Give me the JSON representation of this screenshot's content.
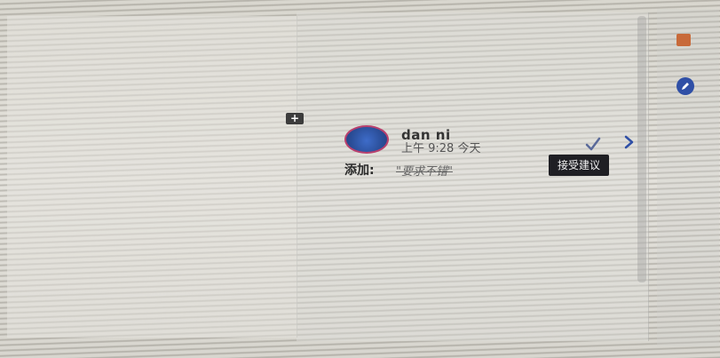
{
  "comment": {
    "author": "dan ni",
    "time": "上午 9:28 今天",
    "change_label": "添加:",
    "change_text": "\"要求不错\""
  },
  "actions": {
    "accept_icon": "checkmark-icon",
    "next_icon": "chevron-right-icon",
    "accept_tooltip": "接受建议",
    "add_comment_icon": "plus-icon"
  },
  "sidebar": {
    "orange_icon": "square-icon",
    "blue_icon": "circle-icon"
  },
  "colors": {
    "avatar_border": "#b8406e",
    "avatar_fill": "#3e6cc9",
    "tooltip_bg": "#1f1f24",
    "accent_blue": "#2f4fa6",
    "accent_orange": "#c86a3a"
  }
}
